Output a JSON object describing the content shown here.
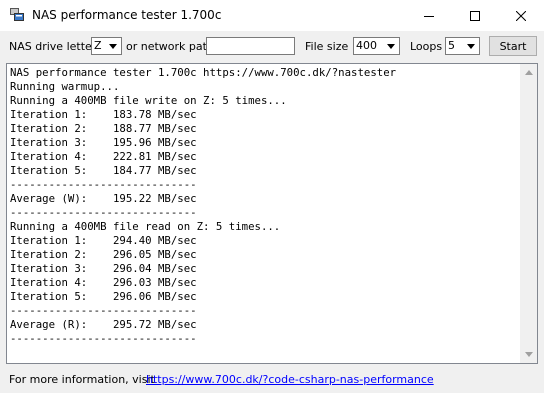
{
  "window": {
    "title": "NAS performance tester 1.700c",
    "app_icon": "nas-app-icon",
    "controls": [
      "minimize-icon",
      "maximize-icon",
      "close-icon"
    ]
  },
  "toolbar": {
    "drive_label": "NAS drive letter",
    "drive_value": "Z",
    "network_label": "or network path",
    "network_value": "",
    "filesize_label": "File size",
    "filesize_value": "400",
    "loops_label": "Loops",
    "loops_value": "5",
    "start_label": "Start"
  },
  "output": {
    "lines": [
      "NAS performance tester 1.700c https://www.700c.dk/?nastester",
      "Running warmup...",
      "Running a 400MB file write on Z: 5 times...",
      "Iteration 1:    183.78 MB/sec",
      "Iteration 2:    188.77 MB/sec",
      "Iteration 3:    195.96 MB/sec",
      "Iteration 4:    222.81 MB/sec",
      "Iteration 5:    184.77 MB/sec",
      "-----------------------------",
      "Average (W):    195.22 MB/sec",
      "-----------------------------",
      "Running a 400MB file read on Z: 5 times...",
      "Iteration 1:    294.40 MB/sec",
      "Iteration 2:    296.05 MB/sec",
      "Iteration 3:    296.04 MB/sec",
      "Iteration 4:    296.03 MB/sec",
      "Iteration 5:    296.06 MB/sec",
      "-----------------------------",
      "Average (R):    295.72 MB/sec",
      "-----------------------------"
    ]
  },
  "footer": {
    "info_label": "For more information, visit",
    "link_text": "https://www.700c.dk/?code-csharp-nas-performance"
  },
  "colors": {
    "link": "#0000ff",
    "titlebar_bg": "#ffffff",
    "window_bg": "#f0f0f0"
  }
}
